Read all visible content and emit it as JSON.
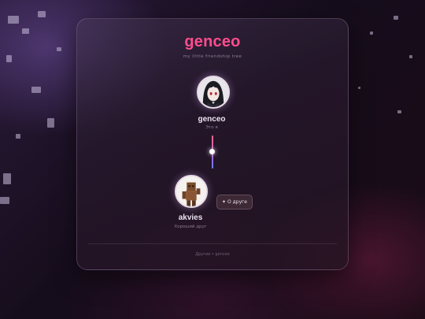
{
  "header": {
    "title": "genceo",
    "tagline": "my little friendship tree"
  },
  "root": {
    "name": "genceo",
    "subtitle": "Это я",
    "avatar_icon": "anime-girl-avatar"
  },
  "child": {
    "name": "akvies",
    "subtitle": "Хороший друг",
    "avatar_icon": "minecraft-character-avatar"
  },
  "about_button": {
    "icon": "✦",
    "label": "О друге"
  },
  "footer": {
    "text": "Другие • genceo"
  },
  "colors": {
    "brand": "#ff4d8d",
    "connector_top": "#ff6a8a",
    "connector_bottom": "#6b7cff"
  }
}
